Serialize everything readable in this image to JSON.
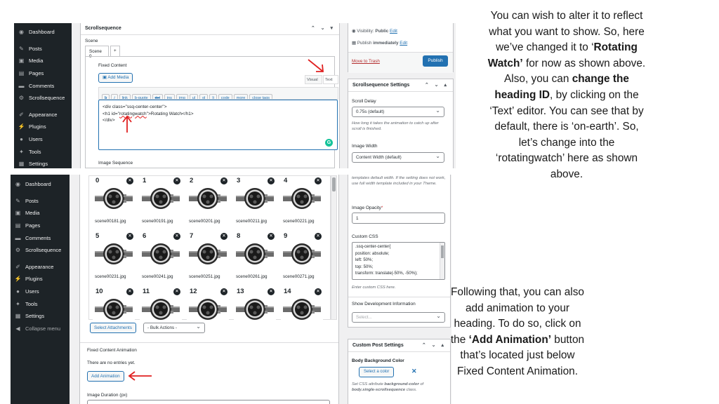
{
  "sidebar": {
    "items": [
      {
        "label": "Dashboard",
        "icon": "dashboard-icon"
      },
      {
        "label": "Posts",
        "icon": "pin-icon"
      },
      {
        "label": "Media",
        "icon": "media-icon"
      },
      {
        "label": "Pages",
        "icon": "pages-icon"
      },
      {
        "label": "Comments",
        "icon": "comments-icon"
      },
      {
        "label": "Scrollsequence",
        "icon": "scrollsequence-icon"
      },
      {
        "label": "Appearance",
        "icon": "brush-icon"
      },
      {
        "label": "Plugins",
        "icon": "plugin-icon"
      },
      {
        "label": "Users",
        "icon": "users-icon"
      },
      {
        "label": "Tools",
        "icon": "wrench-icon"
      },
      {
        "label": "Settings",
        "icon": "settings-icon"
      }
    ],
    "collapse_label": "Collapse menu"
  },
  "top_editor": {
    "box_title": "Scrollsequence",
    "scene_label": "Scene",
    "tab_label": "Scene 0",
    "add_tab": "+",
    "fixed_content_label": "Fixed Content",
    "add_media": "Add Media",
    "tab_visual": "Visual",
    "tab_text": "Text",
    "quicktags": [
      "b",
      "i",
      "link",
      "b-quote",
      "del",
      "ins",
      "img",
      "ul",
      "ol",
      "li",
      "code",
      "more",
      "close tags"
    ],
    "code_lines": [
      "<div class=\"ssq-center-center\">",
      "<h1 id=\"rotatingwatch\">Rotating Watch</h1>",
      "</div>"
    ],
    "grammarly": "G",
    "image_sequence_label": "Image Sequence"
  },
  "top_side": {
    "visibility_label": "Visibility:",
    "visibility_value": "Public",
    "visibility_edit": "Edit",
    "publish_label": "Publish",
    "publish_value": "immediately",
    "publish_edit": "Edit",
    "trash": "Move to Trash",
    "publish_button": "Publish",
    "settings_title": "Scrollsequence Settings",
    "scroll_delay_label": "Scroll Delay",
    "scroll_delay_value": "0.75s (default)",
    "scroll_delay_help": "How long it takes the animation to catch up after scroll is finished.",
    "image_width_label": "Image Width",
    "image_width_value": "Content Width (default)"
  },
  "gallery": {
    "tiles": [
      {
        "num": "0",
        "file": "scene00181.jpg"
      },
      {
        "num": "1",
        "file": "scene00191.jpg"
      },
      {
        "num": "2",
        "file": "scene00201.jpg"
      },
      {
        "num": "3",
        "file": "scene00211.jpg"
      },
      {
        "num": "4",
        "file": "scene00221.jpg"
      },
      {
        "num": "5",
        "file": "scene00231.jpg"
      },
      {
        "num": "6",
        "file": "scene00241.jpg"
      },
      {
        "num": "7",
        "file": "scene00251.jpg"
      },
      {
        "num": "8",
        "file": "scene00261.jpg"
      },
      {
        "num": "9",
        "file": "scene00271.jpg"
      },
      {
        "num": "10",
        "file": ""
      },
      {
        "num": "11",
        "file": ""
      },
      {
        "num": "12",
        "file": ""
      },
      {
        "num": "13",
        "file": ""
      },
      {
        "num": "14",
        "file": ""
      }
    ],
    "select_attachments": "Select Attachments",
    "bulk_actions": "- Bulk Actions -",
    "fixed_anim_label": "Fixed Content Animation",
    "no_entries": "There are no entries yet.",
    "add_animation": "Add Animation",
    "image_duration_label": "Image Duration (px)"
  },
  "bottom_side": {
    "width_help": "templates default width. If the setting does not work, use full width template included in your Theme.",
    "opacity_label": "Image Opacity",
    "opacity_value": "1",
    "css_label": "Custom CSS",
    "css_lines": [
      ".ssq-center-center{",
      "position: absolute;",
      "left: 50%;",
      "top: 50%;",
      "transform: translate(-50%, -50%);"
    ],
    "css_help": "Enter custom CSS here.",
    "dev_label": "Show Development Information",
    "dev_placeholder": "Select...",
    "post_settings_title": "Custom Post Settings",
    "bg_label": "Body Background Color",
    "select_color": "Select a color",
    "bg_help_1": "Set CSS attribute",
    "bg_help_attr": "background-color",
    "bg_help_2": "of",
    "bg_help_3": "body.single-scrollsequence",
    "bg_help_4": "class."
  },
  "narration": {
    "p1": {
      "a": "You can wish to alter it to reflect what you want to show. So, here we’ve changed it to ‘",
      "b": "Rotating Watch’",
      "c": " for now as shown above."
    },
    "p2": {
      "a": "Also, you can ",
      "b": "change the heading ID",
      "c": ", by clicking on the ‘Text’ editor. You can see that by default, there is ‘on-earth’. So, let’s change into the ‘rotatingwatch’ here as shown above."
    },
    "p3": {
      "a": "Following that, you can also add animation to your heading. To do so, click on the ",
      "b": "‘Add Animation’",
      "c": " button that’s located just below Fixed Content Animation."
    }
  },
  "colors": {
    "sidebar": "#1d2327",
    "wp_blue": "#2271b1",
    "arrow_red": "#e02020",
    "panel_bg": "#f0f0f1"
  }
}
